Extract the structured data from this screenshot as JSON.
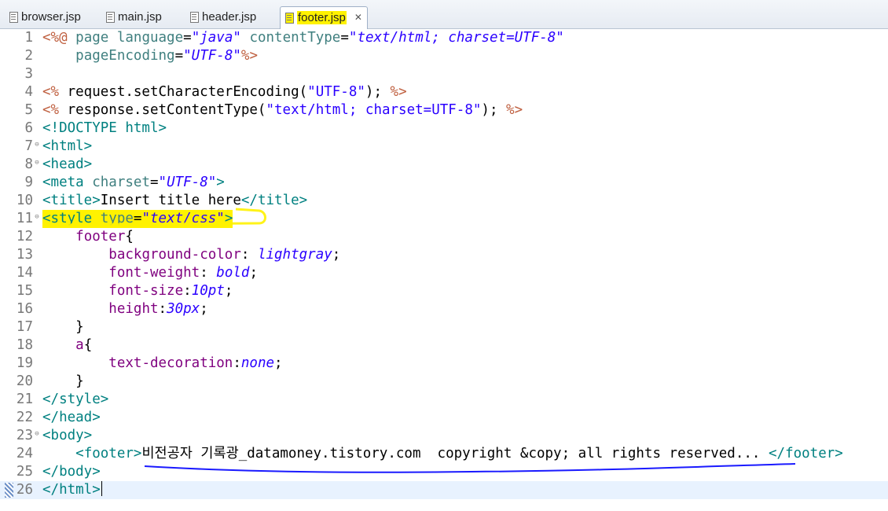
{
  "tabs": [
    {
      "label": "browser.jsp",
      "active": false
    },
    {
      "label": "main.jsp",
      "active": false
    },
    {
      "label": "header.jsp",
      "active": false
    },
    {
      "label": "footer.jsp",
      "active": true
    }
  ],
  "lines": [
    {
      "n": "1",
      "fold": "",
      "parts": [
        [
          "d",
          "<%@ "
        ],
        [
          "k",
          "page "
        ],
        [
          "k",
          "language"
        ],
        [
          "t",
          "="
        ],
        [
          "v",
          "\"java\""
        ],
        [
          "t",
          " "
        ],
        [
          "k",
          "contentType"
        ],
        [
          "t",
          "="
        ],
        [
          "v",
          "\"text/html; charset=UTF-8\""
        ]
      ]
    },
    {
      "n": "2",
      "fold": "",
      "parts": [
        [
          "t",
          "    "
        ],
        [
          "k",
          "pageEncoding"
        ],
        [
          "t",
          "="
        ],
        [
          "v",
          "\"UTF-8\""
        ],
        [
          "d",
          "%>"
        ]
      ]
    },
    {
      "n": "3",
      "fold": "",
      "parts": []
    },
    {
      "n": "4",
      "fold": "",
      "parts": [
        [
          "d",
          "<% "
        ],
        [
          "t",
          "request.setCharacterEncoding("
        ],
        [
          "s",
          "\"UTF-8\""
        ],
        [
          "t",
          "); "
        ],
        [
          "d",
          "%>"
        ]
      ]
    },
    {
      "n": "5",
      "fold": "",
      "parts": [
        [
          "d",
          "<% "
        ],
        [
          "t",
          "response.setContentType("
        ],
        [
          "s",
          "\"text/html; charset=UTF-8\""
        ],
        [
          "t",
          "); "
        ],
        [
          "d",
          "%>"
        ]
      ]
    },
    {
      "n": "6",
      "fold": "",
      "parts": [
        [
          "g",
          "<!DOCTYPE html>"
        ]
      ]
    },
    {
      "n": "7",
      "fold": "⊖",
      "parts": [
        [
          "g",
          "<html>"
        ]
      ]
    },
    {
      "n": "8",
      "fold": "⊖",
      "parts": [
        [
          "g",
          "<head>"
        ]
      ]
    },
    {
      "n": "9",
      "fold": "",
      "parts": [
        [
          "g",
          "<meta "
        ],
        [
          "k",
          "charset"
        ],
        [
          "t",
          "="
        ],
        [
          "v",
          "\"UTF-8\""
        ],
        [
          "g",
          ">"
        ]
      ]
    },
    {
      "n": "10",
      "fold": "",
      "parts": [
        [
          "g",
          "<title>"
        ],
        [
          "t",
          "Insert title here"
        ],
        [
          "g",
          "</title>"
        ]
      ]
    },
    {
      "n": "11",
      "fold": "⊖",
      "parts": [
        [
          "g",
          "<style "
        ],
        [
          "k",
          "type"
        ],
        [
          "t",
          "="
        ],
        [
          "v",
          "\"text/css\""
        ],
        [
          "g",
          ">"
        ]
      ],
      "highlight": true
    },
    {
      "n": "12",
      "fold": "",
      "parts": [
        [
          "t",
          "    "
        ],
        [
          "an",
          "footer"
        ],
        [
          "t",
          "{"
        ]
      ]
    },
    {
      "n": "13",
      "fold": "",
      "parts": [
        [
          "t",
          "        "
        ],
        [
          "an",
          "background-color"
        ],
        [
          "t",
          ": "
        ],
        [
          "v",
          "lightgray"
        ],
        [
          "t",
          ";"
        ]
      ]
    },
    {
      "n": "14",
      "fold": "",
      "parts": [
        [
          "t",
          "        "
        ],
        [
          "an",
          "font-weight"
        ],
        [
          "t",
          ": "
        ],
        [
          "v",
          "bold"
        ],
        [
          "t",
          ";"
        ]
      ]
    },
    {
      "n": "15",
      "fold": "",
      "parts": [
        [
          "t",
          "        "
        ],
        [
          "an",
          "font-size"
        ],
        [
          "t",
          ":"
        ],
        [
          "v",
          "10pt"
        ],
        [
          "t",
          ";"
        ]
      ]
    },
    {
      "n": "16",
      "fold": "",
      "parts": [
        [
          "t",
          "        "
        ],
        [
          "an",
          "height"
        ],
        [
          "t",
          ":"
        ],
        [
          "v",
          "30px"
        ],
        [
          "t",
          ";"
        ]
      ]
    },
    {
      "n": "17",
      "fold": "",
      "parts": [
        [
          "t",
          "    }"
        ]
      ]
    },
    {
      "n": "18",
      "fold": "",
      "parts": [
        [
          "t",
          "    "
        ],
        [
          "an",
          "a"
        ],
        [
          "t",
          "{"
        ]
      ]
    },
    {
      "n": "19",
      "fold": "",
      "parts": [
        [
          "t",
          "        "
        ],
        [
          "an",
          "text-decoration"
        ],
        [
          "t",
          ":"
        ],
        [
          "v",
          "none"
        ],
        [
          "t",
          ";"
        ]
      ]
    },
    {
      "n": "20",
      "fold": "",
      "parts": [
        [
          "t",
          "    }"
        ]
      ]
    },
    {
      "n": "21",
      "fold": "",
      "parts": [
        [
          "g",
          "</style>"
        ]
      ]
    },
    {
      "n": "22",
      "fold": "",
      "parts": [
        [
          "g",
          "</head>"
        ]
      ]
    },
    {
      "n": "23",
      "fold": "⊖",
      "parts": [
        [
          "g",
          "<body>"
        ]
      ]
    },
    {
      "n": "24",
      "fold": "",
      "parts": [
        [
          "t",
          "    "
        ],
        [
          "g",
          "<footer>"
        ],
        [
          "t",
          "비전공자 기록광_datamoney.tistory.com  copyright &copy; all rights reserved... "
        ],
        [
          "g",
          "</footer>"
        ]
      ]
    },
    {
      "n": "25",
      "fold": "",
      "parts": [
        [
          "g",
          "</body>"
        ]
      ]
    },
    {
      "n": "26",
      "fold": "",
      "parts": [
        [
          "g",
          "</html>"
        ]
      ],
      "current": true
    }
  ]
}
